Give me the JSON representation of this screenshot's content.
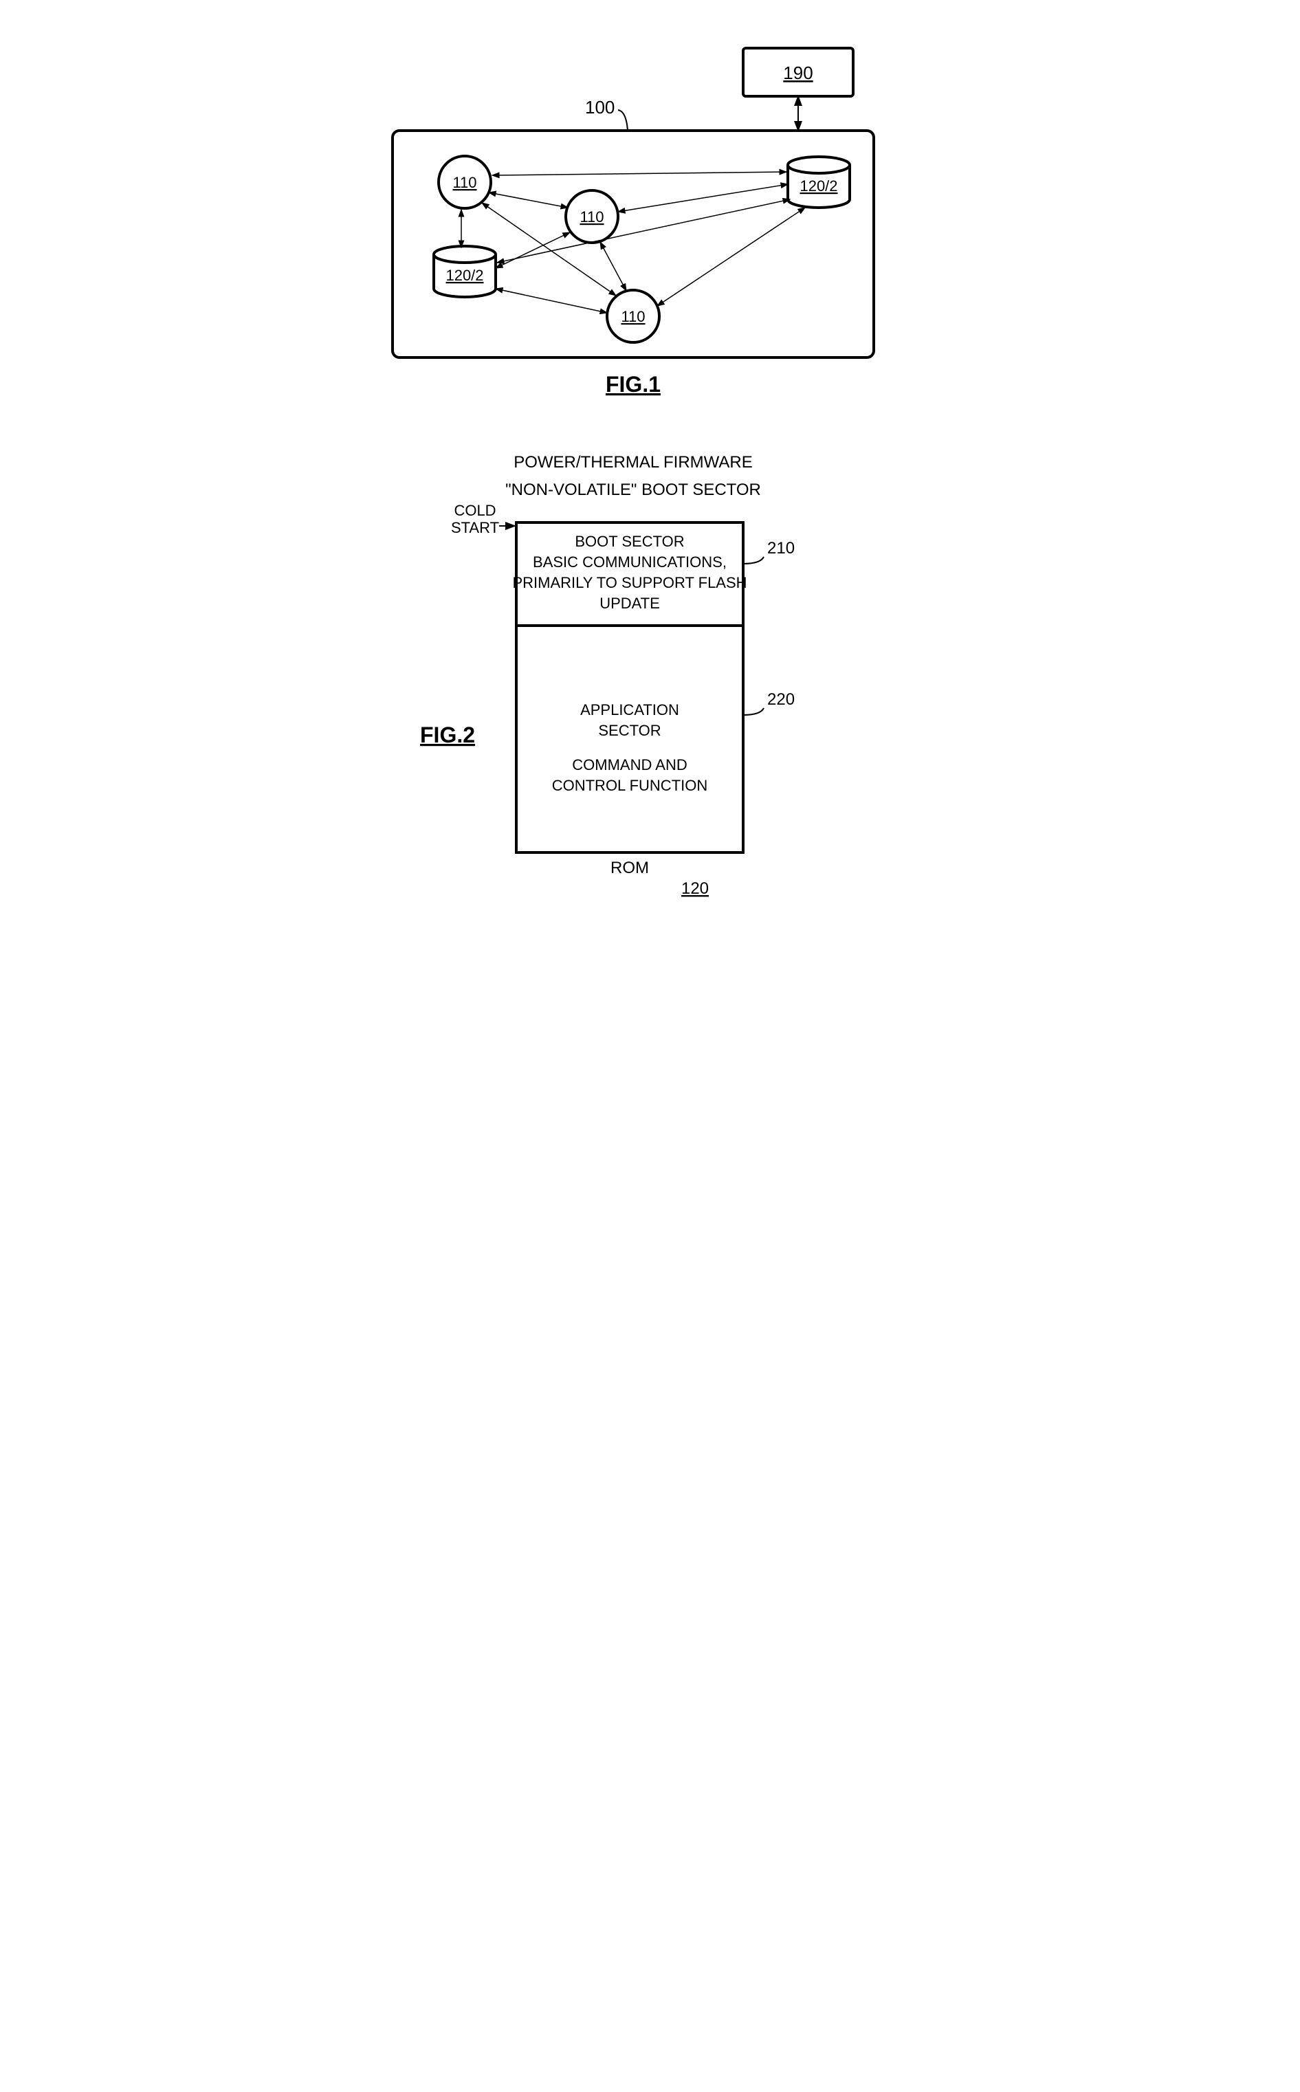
{
  "fig1": {
    "caption": "FIG.1",
    "outer_box_label": "100",
    "external_box_label": "190",
    "nodes": {
      "n110a": "110",
      "n110b": "110",
      "n110c": "110",
      "n120a": "120/2",
      "n120b": "120/2"
    }
  },
  "fig2": {
    "caption": "FIG.2",
    "title1": "POWER/THERMAL FIRMWARE",
    "title2": "\"NON-VOLATILE\" BOOT SECTOR",
    "cold_start": "COLD\nSTART",
    "boot_sector_lines": [
      "BOOT SECTOR",
      "BASIC COMMUNICATIONS,",
      "PRIMARILY TO SUPPORT FLASH",
      "UPDATE"
    ],
    "app_sector_lines": [
      "APPLICATION",
      "SECTOR",
      "",
      "COMMAND AND",
      "CONTROL FUNCTION"
    ],
    "label_210": "210",
    "label_220": "220",
    "rom_label": "ROM",
    "rom_num": "120"
  }
}
